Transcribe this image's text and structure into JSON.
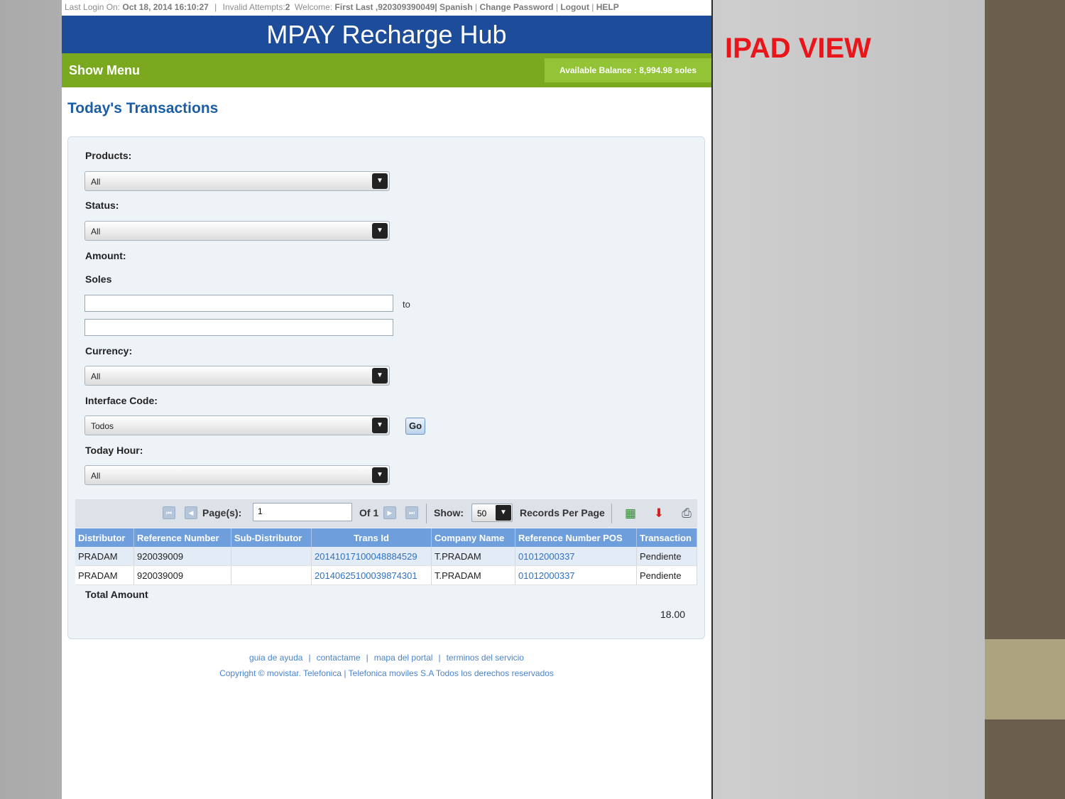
{
  "annotation": "IPAD VIEW",
  "topbar": {
    "last_login_label": "Last Login On:",
    "last_login_value": "Oct 18, 2014 16:10:27",
    "invalid_label": "Invalid Attempts:",
    "invalid_value": "2",
    "welcome_label": "Welcome:",
    "welcome_value": "First Last ,920309390049|",
    "spanish": "Spanish",
    "change_password": "Change Password",
    "logout": "Logout",
    "help": "HELP"
  },
  "header": {
    "title": "MPAY Recharge Hub"
  },
  "menubar": {
    "show_menu": "Show Menu",
    "balance": "Available Balance : 8,994.98 soles"
  },
  "page": {
    "title": "Today's Transactions"
  },
  "filters": {
    "products_label": "Products:",
    "products_value": "All",
    "status_label": "Status:",
    "status_value": "All",
    "amount_label": "Amount:",
    "soles_label": "Soles",
    "to_label": "to",
    "currency_label": "Currency:",
    "currency_value": "All",
    "interface_label": "Interface Code:",
    "interface_value": "Todos",
    "go_label": "Go",
    "hour_label": "Today Hour:",
    "hour_value": "All"
  },
  "pager": {
    "pages_label": "Page(s):",
    "page_value": "1",
    "of_label": "Of 1",
    "show_label": "Show:",
    "show_value": "50",
    "records_label": "Records Per Page"
  },
  "table": {
    "headers": [
      "Distributor",
      "Reference Number",
      "Sub-Distributor",
      "Trans Id",
      "Company Name",
      "Reference Number POS",
      "Transaction"
    ],
    "rows": [
      [
        "PRADAM",
        "920039009",
        "",
        "20141017100048884529",
        "T.PRADAM",
        "01012000337",
        "Pendiente"
      ],
      [
        "PRADAM",
        "920039009",
        "",
        "20140625100039874301",
        "T.PRADAM",
        "01012000337",
        "Pendiente"
      ]
    ]
  },
  "totals": {
    "label": "Total Amount",
    "value": "18.00"
  },
  "footer": {
    "links": [
      "guia de  ayuda",
      "contactame",
      "mapa del portal",
      "terminos del servicio"
    ],
    "copyright": "Copyright © movistar. Telefonica | Telefonica moviles S.A Todos los derechos reservados"
  },
  "colors": {
    "header": "#1d4c9a",
    "menubar": "#7aa91f",
    "title": "#1c5ea6",
    "annotation": "#e8161a"
  }
}
